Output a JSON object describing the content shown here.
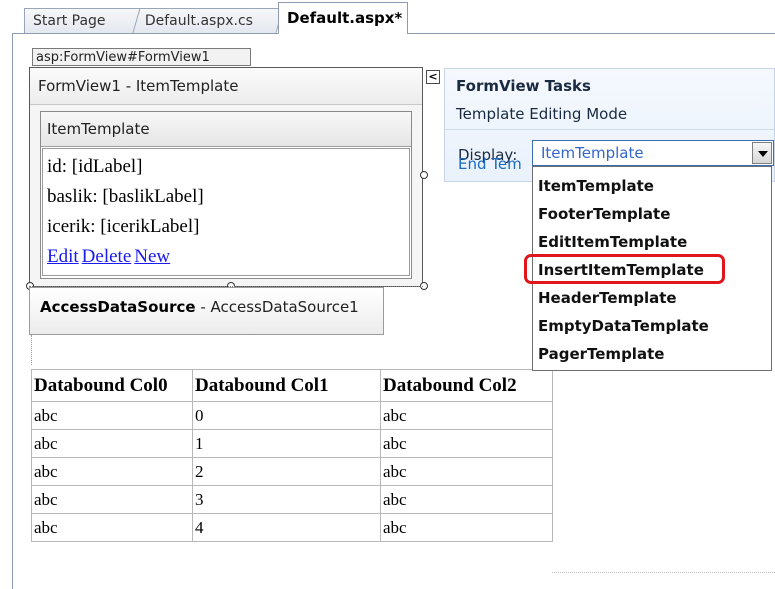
{
  "tabs": [
    {
      "label": "Start Page"
    },
    {
      "label": "Default.aspx.cs"
    },
    {
      "label": "Default.aspx*"
    }
  ],
  "formview": {
    "tag": "asp:FormView#FormView1",
    "header": "FormView1 - ItemTemplate",
    "template_header": "ItemTemplate",
    "fields": [
      {
        "text": "id: [idLabel]"
      },
      {
        "text": "baslik: [baslikLabel]"
      },
      {
        "text": "icerik: [icerikLabel]"
      }
    ],
    "links": {
      "edit": "Edit",
      "delete": "Delete",
      "new": "New"
    }
  },
  "datasource": {
    "type_label": "AccessDataSource",
    "name_label": " - AccessDataSource1"
  },
  "table": {
    "headers": [
      "Databound Col0",
      "Databound Col1",
      "Databound Col2"
    ],
    "rows": [
      [
        "abc",
        "0",
        "abc"
      ],
      [
        "abc",
        "1",
        "abc"
      ],
      [
        "abc",
        "2",
        "abc"
      ],
      [
        "abc",
        "3",
        "abc"
      ],
      [
        "abc",
        "4",
        "abc"
      ]
    ]
  },
  "tasks": {
    "collapse_glyph": "<",
    "title": "FormView Tasks",
    "subtitle": "Template Editing Mode",
    "display_label": "Display:",
    "selected": "ItemTemplate",
    "end_link": "End Tem",
    "options": [
      "ItemTemplate",
      "FooterTemplate",
      "EditItemTemplate",
      "InsertItemTemplate",
      "HeaderTemplate",
      "EmptyDataTemplate",
      "PagerTemplate"
    ],
    "highlighted_option": "InsertItemTemplate",
    "highlight_color": "#e0161c"
  }
}
